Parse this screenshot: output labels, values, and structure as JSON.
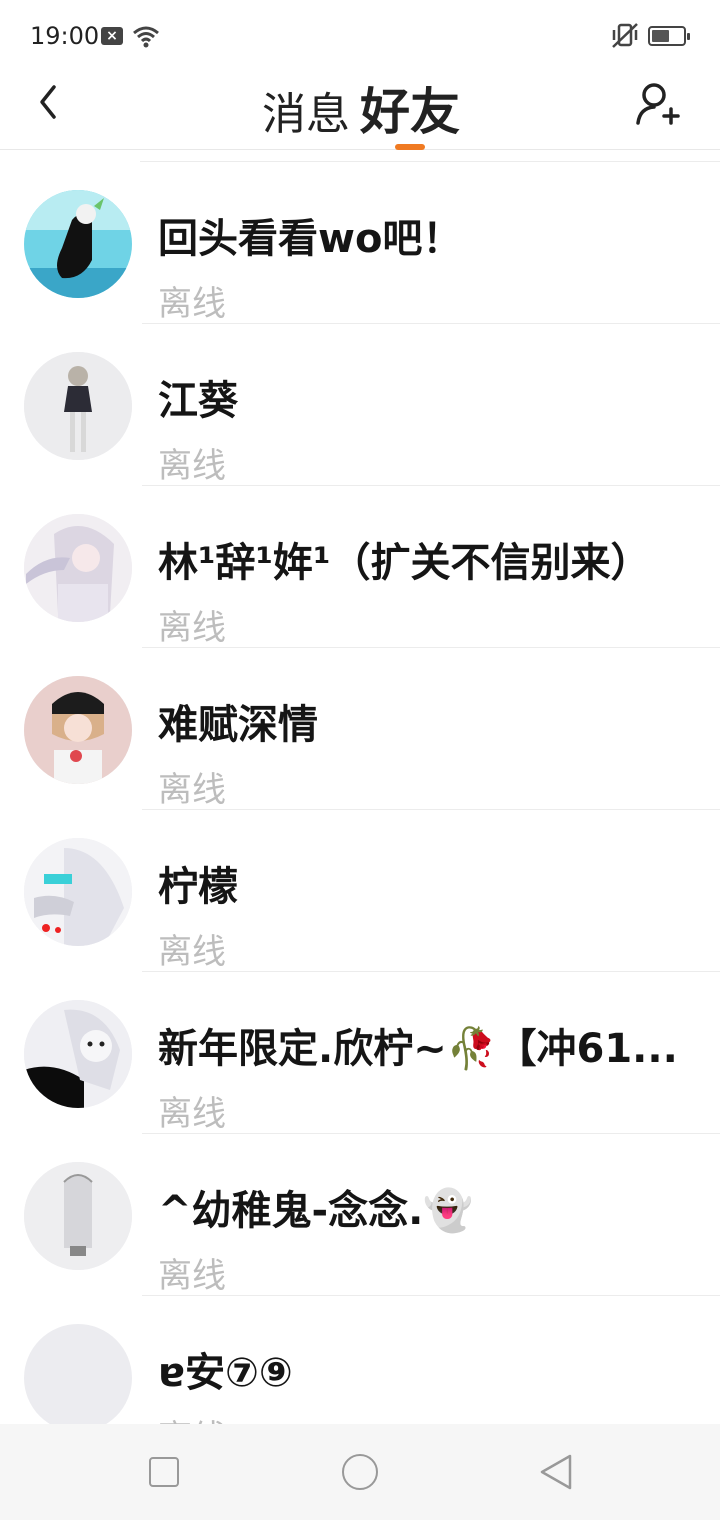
{
  "status_bar": {
    "time": "19:00",
    "notification_icon": "x-box-icon",
    "wifi_icon": "wifi-icon",
    "mute_icon": "vibrate-off-icon",
    "battery_level": 0.55
  },
  "header": {
    "tabs": [
      {
        "label": "消息",
        "active": false
      },
      {
        "label": "好友",
        "active": true
      }
    ],
    "back_icon": "chevron-left-icon",
    "add_friend_icon": "add-user-icon",
    "accent_color": "#f07a22"
  },
  "partial_row_text": "…(部分被遮挡)…",
  "friends": [
    {
      "name": "回头看看wo吧！",
      "status": "离线"
    },
    {
      "name": "江葵",
      "status": "离线"
    },
    {
      "name": "林¹辞¹姩¹（扩关不信别来）",
      "status": "离线"
    },
    {
      "name": "难赋深情",
      "status": "离线"
    },
    {
      "name": "柠檬",
      "status": "离线"
    },
    {
      "name": "新年限定.欣柠~🥀【冲61...",
      "status": "离线"
    },
    {
      "name": "^幼稚鬼-念念.👻",
      "status": "离线"
    },
    {
      "name": "ɐ安⑦⑨",
      "status": "离线"
    }
  ],
  "nav_bar": {
    "recent_icon": "square-icon",
    "home_icon": "circle-icon",
    "back_icon": "triangle-back-icon"
  }
}
